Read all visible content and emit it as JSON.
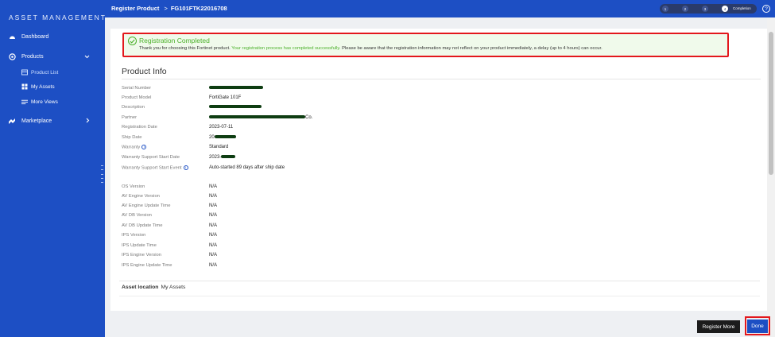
{
  "sidebar": {
    "title": "ASSET MANAGEMENT",
    "items": [
      {
        "label": "Dashboard",
        "icon": "dashboard-icon"
      },
      {
        "label": "Products",
        "icon": "products-icon"
      },
      {
        "label": "Marketplace",
        "icon": "marketplace-icon"
      }
    ],
    "sub_items": [
      {
        "label": "Product List",
        "icon": "list-icon"
      },
      {
        "label": "My Assets",
        "icon": "assets-icon"
      },
      {
        "label": "More Views",
        "icon": "views-icon"
      }
    ]
  },
  "header": {
    "breadcrumb_root": "Register Product",
    "breadcrumb_sep": ">",
    "breadcrumb_serial": "FG101FTK22016708",
    "steps": [
      "1",
      "2",
      "3",
      "4"
    ],
    "current_step_label": "Completion",
    "help": "?"
  },
  "alert": {
    "title": "Registration Completed",
    "msg_start": "Thank you for choosing this Fortinet product.",
    "msg_highlight": "Your registration process has completed successfully.",
    "msg_end": "Please be aware that the registration information may not reflect on your product immediately, a delay (up to 4 hours) can occur."
  },
  "product_info": {
    "title": "Product Info",
    "rows": [
      {
        "label": "Serial Number",
        "value": ""
      },
      {
        "label": "Product Model",
        "value": "FortiGate 101F"
      },
      {
        "label": "Description",
        "value": ""
      },
      {
        "label": "Partner",
        "value": "Co."
      },
      {
        "label": "Registration Date",
        "value": "2023-07-11"
      },
      {
        "label": "Ship Date",
        "value": "20"
      },
      {
        "label": "Warranty",
        "value": "Standard"
      },
      {
        "label": "Warranty Support Start Date",
        "value": "2023-"
      },
      {
        "label": "Warranty Support Start Event",
        "value": "Auto-started 89 days after ship date"
      }
    ],
    "versions": [
      {
        "label": "OS Version",
        "value": "N/A"
      },
      {
        "label": "AV Engine Version",
        "value": "N/A"
      },
      {
        "label": "AV Engine Update Time",
        "value": "N/A"
      },
      {
        "label": "AV DB Version",
        "value": "N/A"
      },
      {
        "label": "AV DB Update Time",
        "value": "N/A"
      },
      {
        "label": "IPS Version",
        "value": "N/A"
      },
      {
        "label": "IPS Update Time",
        "value": "N/A"
      },
      {
        "label": "IPS Engine Version",
        "value": "N/A"
      },
      {
        "label": "IPS Engine Update Time",
        "value": "N/A"
      }
    ]
  },
  "asset_location": {
    "label": "Asset location",
    "value": "My Assets"
  },
  "buttons": {
    "register_more": "Register More",
    "done": "Done"
  },
  "colors": {
    "brand": "#1d4fc4",
    "success": "#4bb02a",
    "highlight_frame": "#e3171c"
  }
}
